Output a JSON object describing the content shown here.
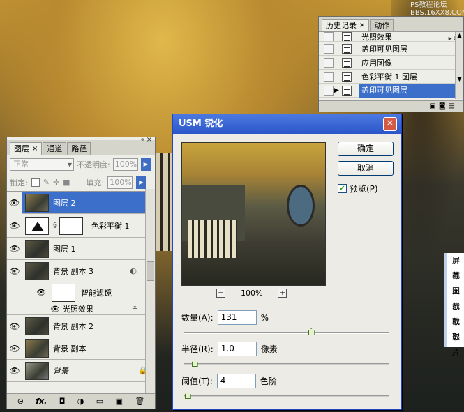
{
  "watermark": {
    "line1": "PS教程论坛",
    "line2": "BBS.16XX8.COM"
  },
  "history": {
    "tabs": [
      "历史记录",
      "动作"
    ],
    "items": [
      {
        "label": "光照效果",
        "selected": false
      },
      {
        "label": "盖印可见图层",
        "selected": false
      },
      {
        "label": "应用图像",
        "selected": false
      },
      {
        "label": "色彩平衡 1 图层",
        "selected": false
      },
      {
        "label": "盖印可见图层",
        "selected": true
      }
    ]
  },
  "layers": {
    "tabs": [
      "图层",
      "通道",
      "路径"
    ],
    "blend_mode": "正常",
    "opacity_label": "不透明度:",
    "opacity_value": "100%",
    "lock_label": "锁定:",
    "fill_label": "填充:",
    "fill_value": "100%",
    "rows": [
      {
        "label": "图层 2",
        "selected": true
      },
      {
        "label": "色彩平衡 1"
      },
      {
        "label": "图层 1"
      },
      {
        "label": "背景 副本 3"
      },
      {
        "label": "智能滤镜"
      },
      {
        "label": "光照效果"
      },
      {
        "label": "背景 副本 2"
      },
      {
        "label": "背景 副本"
      },
      {
        "label": "背景"
      }
    ],
    "footer_fx": "fx."
  },
  "usm": {
    "title": "USM 锐化",
    "ok_label": "确定",
    "cancel_label": "取消",
    "preview_label": "预览(P)",
    "zoom": "100%",
    "amount_label": "数量(A):",
    "amount_value": "131",
    "amount_unit": "%",
    "amount_fraction": 0.62,
    "radius_label": "半径(R):",
    "radius_value": "1.0",
    "radius_unit": "像素",
    "radius_fraction": 0.05,
    "threshold_label": "阈值(T):",
    "threshold_value": "4",
    "threshold_unit": "色阶",
    "threshold_fraction": 0.016
  },
  "context_menu": {
    "items": [
      "屏幕",
      "截图",
      "显示",
      "截取",
      "截取",
      "影片"
    ]
  }
}
